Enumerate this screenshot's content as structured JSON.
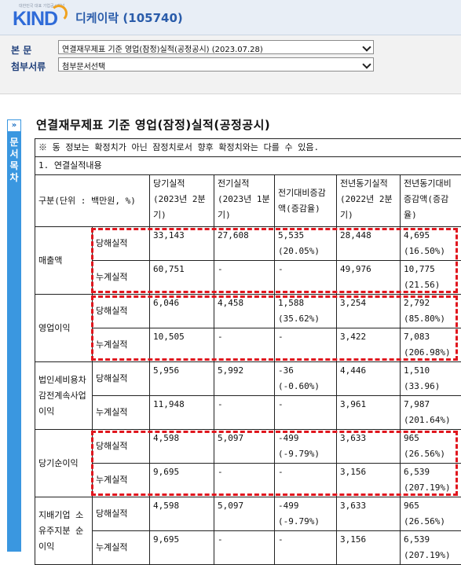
{
  "header": {
    "logo_text": "KIND",
    "logo_tagline": "대한민국 대표 기업공시채널",
    "company": "디케이락 (105740)"
  },
  "filters": {
    "main_label": "본 문",
    "main_value": "연결재무제표 기준 영업(잠정)실적(공정공시) (2023.07.28)",
    "attach_label": "첨부서류",
    "attach_value": "첨부문서선택"
  },
  "sidetab": {
    "toggle": "»",
    "label": "문서목차"
  },
  "document": {
    "title": "연결재무제표 기준 영업(잠정)실적(공정공시)",
    "notice": "※ 동 정보는 확정치가 아닌 잠정치로서 향후 확정치와는 다를 수 있음.",
    "section": "1. 연결실적내용",
    "headers": {
      "unit": "구분(단위 : 백만원, %)",
      "cur": "당기실적 (2023년 2분기)",
      "prev": "전기실적 (2023년 1분기)",
      "qoq": "전기대비증감액(증감율)",
      "yoy": "전년동기실적 (2022년 2분기)",
      "yoy_chg": "전년동기대비증감액(증감율)"
    },
    "rows": [
      {
        "category": "매출액",
        "type": "당해실적",
        "cur": "33,143",
        "prev": "27,608",
        "qoq": "5,535 (20.05%)",
        "yoy": "28,448",
        "yoy_chg": "4,695 (16.50%)"
      },
      {
        "category": "",
        "type": "누계실적",
        "cur": "60,751",
        "prev": "-",
        "qoq": "-",
        "yoy": "49,976",
        "yoy_chg": "10,775 (21.56)"
      },
      {
        "category": "영업이익",
        "type": "당해실적",
        "cur": "6,046",
        "prev": "4,458",
        "qoq": "1,588 (35.62%)",
        "yoy": "3,254",
        "yoy_chg": "2,792 (85.80%)"
      },
      {
        "category": "",
        "type": "누계실적",
        "cur": "10,505",
        "prev": "-",
        "qoq": "-",
        "yoy": "3,422",
        "yoy_chg": "7,083 (206.98%)"
      },
      {
        "category": "법인세비용차감전계속사업이익",
        "type": "당해실적",
        "cur": "5,956",
        "prev": "5,992",
        "qoq": "-36 (-0.60%)",
        "yoy": "4,446",
        "yoy_chg": "1,510 (33.96)"
      },
      {
        "category": "",
        "type": "누계실적",
        "cur": "11,948",
        "prev": "-",
        "qoq": "-",
        "yoy": "3,961",
        "yoy_chg": "7,987 (201.64%)"
      },
      {
        "category": "당기순이익",
        "type": "당해실적",
        "cur": "4,598",
        "prev": "5,097",
        "qoq": "-499 (-9.79%)",
        "yoy": "3,633",
        "yoy_chg": "965 (26.56%)"
      },
      {
        "category": "",
        "type": "누계실적",
        "cur": "9,695",
        "prev": "-",
        "qoq": "-",
        "yoy": "3,156",
        "yoy_chg": "6,539 (207.19%)"
      },
      {
        "category": "지배기업 소유주지분 순이익",
        "type": "당해실적",
        "cur": "4,598",
        "prev": "5,097",
        "qoq": "-499 (-9.79%)",
        "yoy": "3,633",
        "yoy_chg": "965 (26.56%)"
      },
      {
        "category": "",
        "type": "누계실적",
        "cur": "9,695",
        "prev": "-",
        "qoq": "-",
        "yoy": "3,156",
        "yoy_chg": "6,539 (207.19%)"
      }
    ]
  },
  "annotations": {
    "highlight_color": "#e0161e",
    "highlighted_categories": [
      "매출액",
      "영업이익",
      "당기순이익"
    ]
  }
}
